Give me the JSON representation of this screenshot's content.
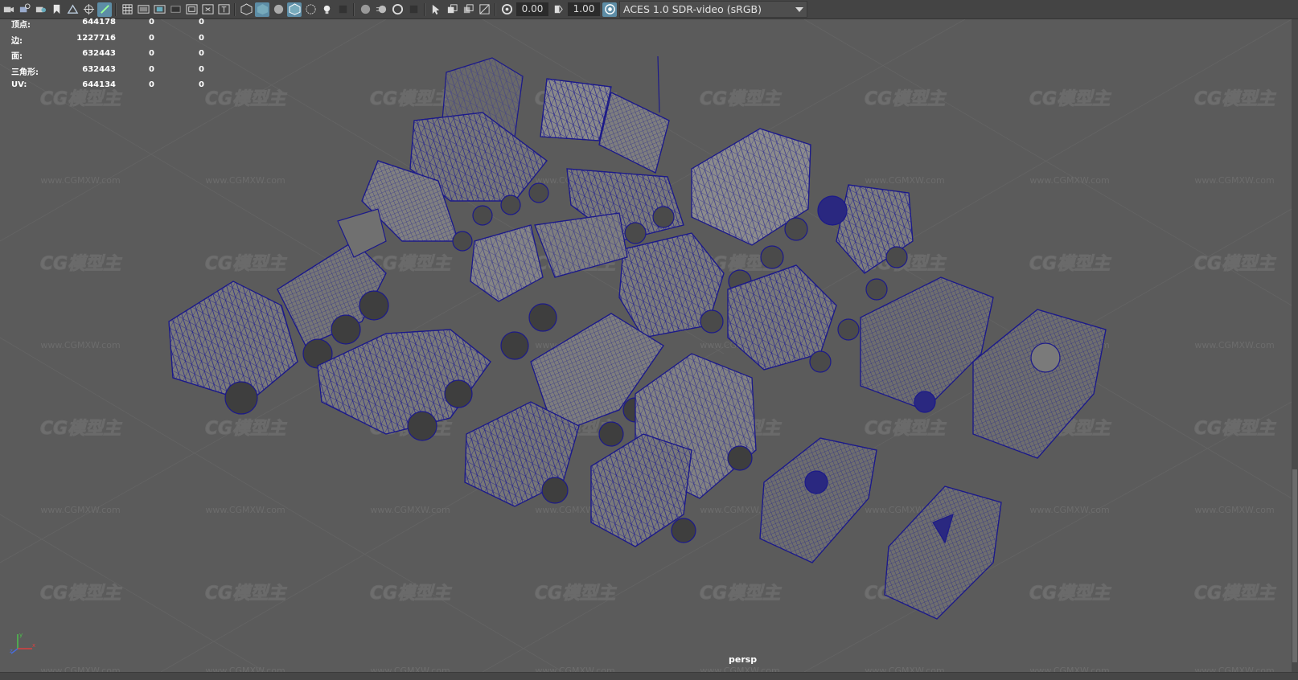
{
  "toolbar": {
    "exposure_value": "0.00",
    "gamma_value": "1.00",
    "color_management": "ACES 1.0 SDR-video (sRGB)"
  },
  "hud": {
    "rows": [
      {
        "label": "顶点:",
        "value": "644178",
        "zero1": "0",
        "zero2": "0"
      },
      {
        "label": "边:",
        "value": "1227716",
        "zero1": "0",
        "zero2": "0"
      },
      {
        "label": "面:",
        "value": "632443",
        "zero1": "0",
        "zero2": "0"
      },
      {
        "label": "三角形:",
        "value": "632443",
        "zero1": "0",
        "zero2": "0"
      },
      {
        "label": "UV:",
        "value": "644134",
        "zero1": "0",
        "zero2": "0"
      }
    ]
  },
  "camera_label": "persp",
  "watermark": {
    "logo_text": "CG模型主",
    "url_text": "www.CGMXW.com"
  },
  "colors": {
    "viewport_bg": "#5b5b5b",
    "wireframe": "#1c1a8a",
    "toolbar_bg": "#444444",
    "active_button": "#5d8da6"
  }
}
